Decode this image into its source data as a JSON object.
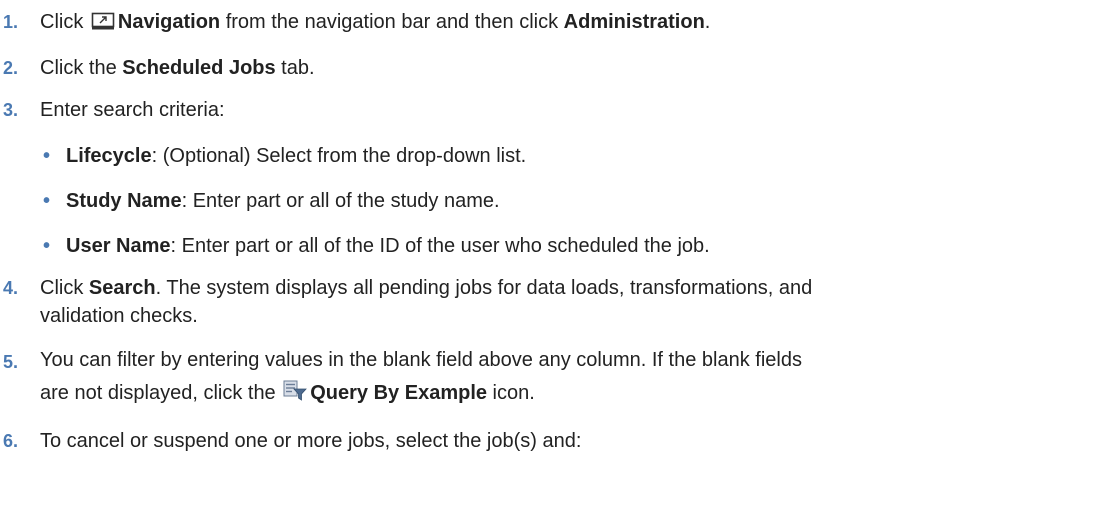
{
  "steps": [
    {
      "num": "1.",
      "pre": "Click ",
      "icon": "navigation-icon",
      "bold1": "Navigation",
      "mid": " from the navigation bar and then click ",
      "bold2": "Administration",
      "post": "."
    },
    {
      "num": "2.",
      "pre": "Click the ",
      "bold1": "Scheduled Jobs",
      "post": " tab."
    },
    {
      "num": "3.",
      "text": "Enter search criteria:",
      "bullets": [
        {
          "bold": "Lifecycle",
          "text": ": (Optional) Select from the drop-down list."
        },
        {
          "bold": "Study Name",
          "text": ": Enter part or all of the study name."
        },
        {
          "bold": "User Name",
          "text": ": Enter part or all of the ID of the user who scheduled the job."
        }
      ]
    },
    {
      "num": "4.",
      "pre": "Click ",
      "bold1": "Search",
      "line1_post": ". The system displays all pending jobs for data loads, transformations, and",
      "line2": "validation checks."
    },
    {
      "num": "5.",
      "line1": "You can filter by entering values in the blank field above any column. If the blank fields",
      "line2_pre": "are not displayed, click the ",
      "icon": "query-by-example-icon",
      "bold1": "Query By Example",
      "line2_post": " icon."
    },
    {
      "num": "6.",
      "text": "To cancel or suspend one or more jobs, select the job(s) and:"
    }
  ],
  "colors": {
    "step_number": "#4a79b2",
    "text": "#222222"
  }
}
